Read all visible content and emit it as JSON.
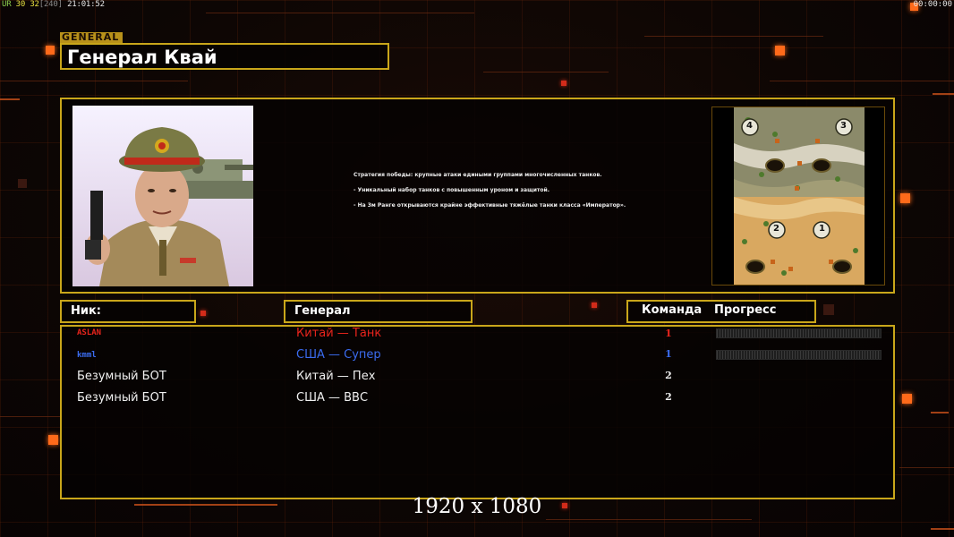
{
  "status": {
    "ur_label": "UR",
    "fps_value": "30",
    "fps_cap": "32",
    "fps_bracket": "[240]",
    "clock": "21:01:52",
    "timer": "00:00:00"
  },
  "general": {
    "section_label": "GENERAL",
    "name": "Генерал Квай",
    "portrait_icon": "general-portrait-icon",
    "description": [
      "Стратегия победы: крупные атаки едиными группами многочисленных танков.",
      "- Уникальный набор танков с повышенным уроном и защитой.",
      "- На 3м Ранге открываются крайне эффективные тяжёлые танки класса «Император»."
    ],
    "minimap_icon": "map-preview-icon",
    "start_positions": [
      "4",
      "3",
      "2",
      "1"
    ]
  },
  "table": {
    "headers": {
      "nick": "Ник:",
      "general": "Генерал",
      "team": "Команда",
      "progress": "Прогресс"
    },
    "rows": [
      {
        "nick": "ASLAN",
        "general": "Китай — Танк",
        "team": "1",
        "color": "#e8241c",
        "nick_small": true,
        "has_progress": true,
        "progress": 0
      },
      {
        "nick": "kmml",
        "general": "США — Супер",
        "team": "1",
        "color": "#3b6cf0",
        "nick_small": true,
        "has_progress": true,
        "progress": 0
      },
      {
        "nick": "Безумный БОТ",
        "general": "Китай — Пех",
        "team": "2",
        "color": "#f0f0f0",
        "nick_small": false,
        "has_progress": false
      },
      {
        "nick": "Безумный БОТ",
        "general": "США — ВВС",
        "team": "2",
        "color": "#f0f0f0",
        "nick_small": false,
        "has_progress": false
      }
    ]
  },
  "resolution": "1920 x 1080",
  "colors": {
    "frame": "#c9a61a",
    "accent_orange": "#ff6a1a",
    "china_red": "#e8241c",
    "usa_blue": "#3b6cf0"
  }
}
